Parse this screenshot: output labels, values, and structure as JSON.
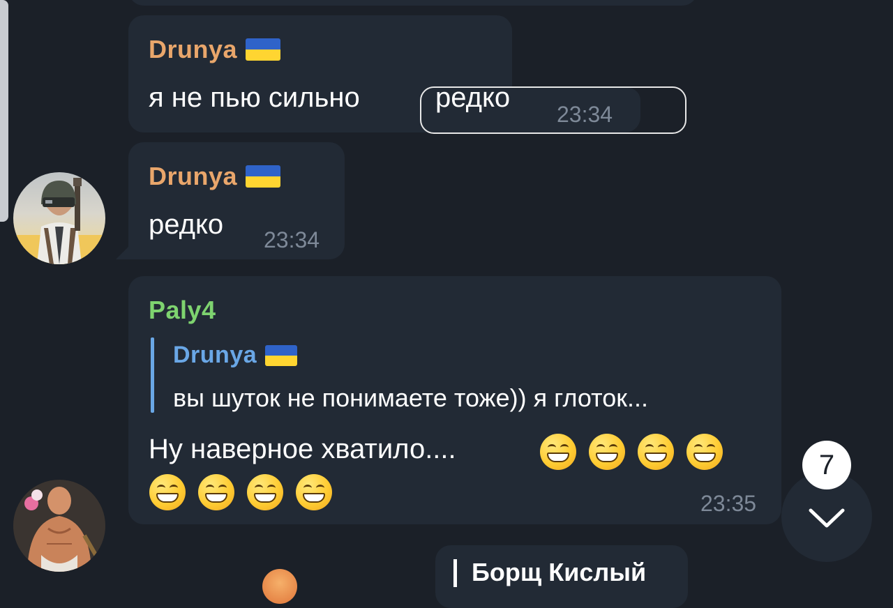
{
  "messages": [
    {
      "sender": "Drunya",
      "text": "я не пью сильно",
      "inline_highlight": "редко",
      "time": "23:34"
    },
    {
      "sender": "Drunya",
      "text": "редко",
      "time": "23:34"
    },
    {
      "sender": "Paly4",
      "reply": {
        "sender": "Drunya",
        "text": "вы шуток не понимаете тоже)) я глоток..."
      },
      "text": "Ну наверное хватило....",
      "emoji": "grinning-face-emoji",
      "emoji_count": 8,
      "time": "23:35"
    },
    {
      "reply": {
        "sender": "Борщ Кислый"
      }
    }
  ],
  "scroll_button": {
    "unread_count": "7",
    "icon": "chevron-down-icon"
  },
  "colors": {
    "background": "#1b2028",
    "bubble": "#222a35",
    "sender_orange": "#e9a66b",
    "sender_green": "#7ed36f",
    "reply_accent": "#6aa7e6",
    "time": "#7e8998"
  }
}
